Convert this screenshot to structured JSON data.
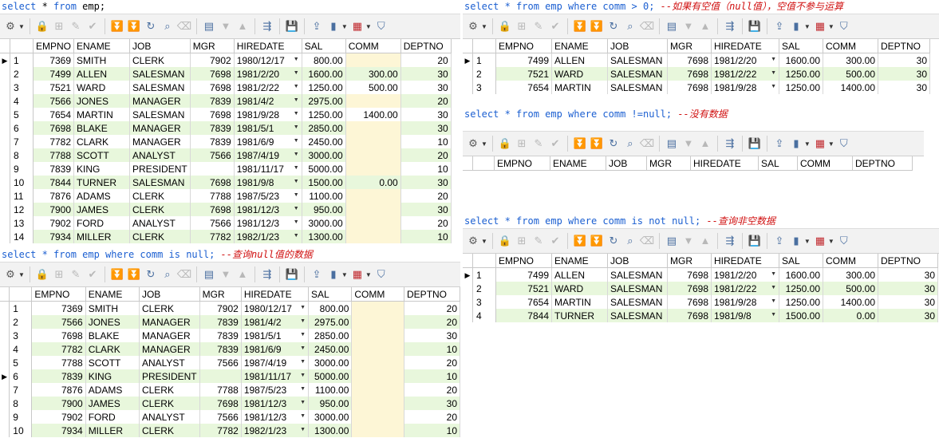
{
  "columns_full": [
    "EMPNO",
    "ENAME",
    "JOB",
    "MGR",
    "HIREDATE",
    "SAL",
    "COMM",
    "DEPTNO"
  ],
  "panels": [
    {
      "id": "p1",
      "sql_kw1": "select",
      "sql_mid": " * ",
      "sql_kw2": "from",
      "sql_rest": " emp;",
      "comment": "",
      "current_row": 1,
      "rows": [
        [
          "1",
          "7369",
          "SMITH",
          "CLERK",
          "7902",
          "1980/12/17",
          "800.00",
          "",
          "20"
        ],
        [
          "2",
          "7499",
          "ALLEN",
          "SALESMAN",
          "7698",
          "1981/2/20",
          "1600.00",
          "300.00",
          "30"
        ],
        [
          "3",
          "7521",
          "WARD",
          "SALESMAN",
          "7698",
          "1981/2/22",
          "1250.00",
          "500.00",
          "30"
        ],
        [
          "4",
          "7566",
          "JONES",
          "MANAGER",
          "7839",
          "1981/4/2",
          "2975.00",
          "",
          "20"
        ],
        [
          "5",
          "7654",
          "MARTIN",
          "SALESMAN",
          "7698",
          "1981/9/28",
          "1250.00",
          "1400.00",
          "30"
        ],
        [
          "6",
          "7698",
          "BLAKE",
          "MANAGER",
          "7839",
          "1981/5/1",
          "2850.00",
          "",
          "30"
        ],
        [
          "7",
          "7782",
          "CLARK",
          "MANAGER",
          "7839",
          "1981/6/9",
          "2450.00",
          "",
          "10"
        ],
        [
          "8",
          "7788",
          "SCOTT",
          "ANALYST",
          "7566",
          "1987/4/19",
          "3000.00",
          "",
          "20"
        ],
        [
          "9",
          "7839",
          "KING",
          "PRESIDENT",
          "",
          "1981/11/17",
          "5000.00",
          "",
          "10"
        ],
        [
          "10",
          "7844",
          "TURNER",
          "SALESMAN",
          "7698",
          "1981/9/8",
          "1500.00",
          "0.00",
          "30"
        ],
        [
          "11",
          "7876",
          "ADAMS",
          "CLERK",
          "7788",
          "1987/5/23",
          "1100.00",
          "",
          "20"
        ],
        [
          "12",
          "7900",
          "JAMES",
          "CLERK",
          "7698",
          "1981/12/3",
          "950.00",
          "",
          "30"
        ],
        [
          "13",
          "7902",
          "FORD",
          "ANALYST",
          "7566",
          "1981/12/3",
          "3000.00",
          "",
          "20"
        ],
        [
          "14",
          "7934",
          "MILLER",
          "CLERK",
          "7782",
          "1982/1/23",
          "1300.00",
          "",
          "10"
        ]
      ]
    },
    {
      "id": "p2",
      "sql_text": "select * from emp where comm is null;",
      "comment": "--查询null值的数据",
      "current_row": 6,
      "rows": [
        [
          "1",
          "7369",
          "SMITH",
          "CLERK",
          "7902",
          "1980/12/17",
          "800.00",
          "",
          "20"
        ],
        [
          "2",
          "7566",
          "JONES",
          "MANAGER",
          "7839",
          "1981/4/2",
          "2975.00",
          "",
          "20"
        ],
        [
          "3",
          "7698",
          "BLAKE",
          "MANAGER",
          "7839",
          "1981/5/1",
          "2850.00",
          "",
          "30"
        ],
        [
          "4",
          "7782",
          "CLARK",
          "MANAGER",
          "7839",
          "1981/6/9",
          "2450.00",
          "",
          "10"
        ],
        [
          "5",
          "7788",
          "SCOTT",
          "ANALYST",
          "7566",
          "1987/4/19",
          "3000.00",
          "",
          "20"
        ],
        [
          "6",
          "7839",
          "KING",
          "PRESIDENT",
          "",
          "1981/11/17",
          "5000.00",
          "",
          "10"
        ],
        [
          "7",
          "7876",
          "ADAMS",
          "CLERK",
          "7788",
          "1987/5/23",
          "1100.00",
          "",
          "20"
        ],
        [
          "8",
          "7900",
          "JAMES",
          "CLERK",
          "7698",
          "1981/12/3",
          "950.00",
          "",
          "30"
        ],
        [
          "9",
          "7902",
          "FORD",
          "ANALYST",
          "7566",
          "1981/12/3",
          "3000.00",
          "",
          "20"
        ],
        [
          "10",
          "7934",
          "MILLER",
          "CLERK",
          "7782",
          "1982/1/23",
          "1300.00",
          "",
          "10"
        ]
      ]
    },
    {
      "id": "p3",
      "sql_text": "select * from emp where comm > 0;",
      "comment": "--如果有空值（null值），空值不参与运算",
      "current_row": 1,
      "rows": [
        [
          "1",
          "7499",
          "ALLEN",
          "SALESMAN",
          "7698",
          "1981/2/20",
          "1600.00",
          "300.00",
          "30"
        ],
        [
          "2",
          "7521",
          "WARD",
          "SALESMAN",
          "7698",
          "1981/2/22",
          "1250.00",
          "500.00",
          "30"
        ],
        [
          "3",
          "7654",
          "MARTIN",
          "SALESMAN",
          "7698",
          "1981/9/28",
          "1250.00",
          "1400.00",
          "30"
        ]
      ]
    },
    {
      "id": "p4",
      "sql_text": "select * from emp where comm !=null;",
      "comment": "--没有数据",
      "current_row": 0,
      "rows": []
    },
    {
      "id": "p5",
      "sql_text": "select * from emp where comm is not null;",
      "comment": "--查询非空数据",
      "current_row": 1,
      "rows": [
        [
          "1",
          "7499",
          "ALLEN",
          "SALESMAN",
          "7698",
          "1981/2/20",
          "1600.00",
          "300.00",
          "30"
        ],
        [
          "2",
          "7521",
          "WARD",
          "SALESMAN",
          "7698",
          "1981/2/22",
          "1250.00",
          "500.00",
          "30"
        ],
        [
          "3",
          "7654",
          "MARTIN",
          "SALESMAN",
          "7698",
          "1981/9/28",
          "1250.00",
          "1400.00",
          "30"
        ],
        [
          "4",
          "7844",
          "TURNER",
          "SALESMAN",
          "7698",
          "1981/9/8",
          "1500.00",
          "0.00",
          "30"
        ]
      ]
    }
  ],
  "toolbar_icons": [
    "grid-settings-icon",
    "lock-icon",
    "insert-record-icon",
    "edit-record-icon",
    "post-check-icon",
    "filter-first-icon",
    "filter-last-icon",
    "refresh-icon",
    "find-icon",
    "clear-icon",
    "query-by-example-icon",
    "sort-down-icon",
    "sort-up-icon",
    "link-icon",
    "save-icon",
    "export-icon",
    "chart-icon",
    "table-view-icon",
    "filter-icon"
  ],
  "colors": {
    "keyword": "#1b5fd1",
    "comment": "#d01010",
    "even_row": "#e8f7dc",
    "null_cell": "#fdf6d6"
  }
}
